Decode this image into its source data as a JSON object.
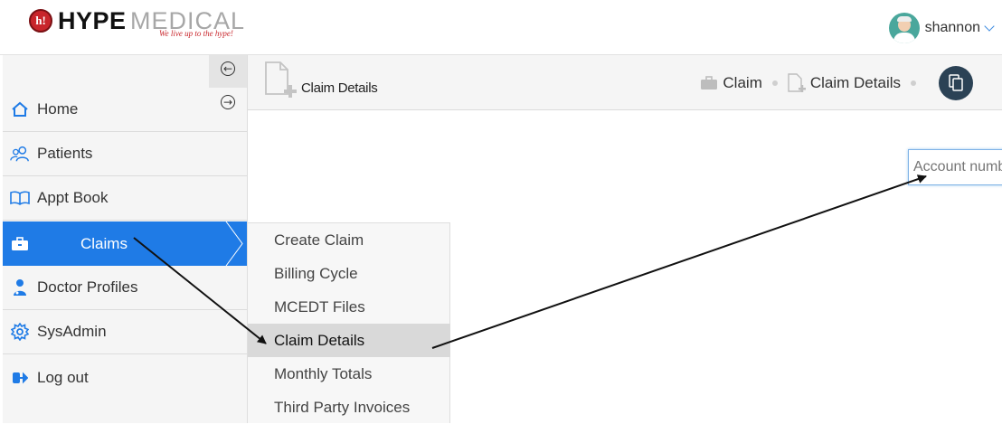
{
  "brand": {
    "logo_letter": "h!",
    "name_part1": "HYPE",
    "name_part2": "MEDICAL",
    "tagline": "We live up to the hype!"
  },
  "user": {
    "name": "shannon",
    "avatar_icon": "doctor-avatar-icon"
  },
  "sidebar": {
    "items": [
      {
        "label": "Home",
        "icon": "home-icon"
      },
      {
        "label": "Patients",
        "icon": "patients-icon"
      },
      {
        "label": "Appt Book",
        "icon": "book-icon"
      },
      {
        "label": "Claims",
        "icon": "briefcase-icon",
        "active": true
      },
      {
        "label": "Doctor Profiles",
        "icon": "doctor-icon"
      },
      {
        "label": "SysAdmin",
        "icon": "gear-icon"
      },
      {
        "label": "Log out",
        "icon": "logout-icon"
      }
    ]
  },
  "claims_menu": {
    "items": [
      {
        "label": "Create Claim"
      },
      {
        "label": "Billing Cycle"
      },
      {
        "label": "MCEDT Files"
      },
      {
        "label": "Claim Details",
        "highlighted": true
      },
      {
        "label": "Monthly Totals"
      },
      {
        "label": "Third Party Invoices"
      }
    ]
  },
  "page": {
    "title": "Claim Details",
    "breadcrumb": [
      {
        "label": "Claim",
        "icon": "briefcase-icon"
      },
      {
        "label": "Claim Details",
        "icon": "add-file-icon"
      }
    ]
  },
  "search": {
    "placeholder": "Account number"
  },
  "colors": {
    "accent": "#1f7be6",
    "brand_red": "#c8252b",
    "dark_button": "#2b4255"
  }
}
